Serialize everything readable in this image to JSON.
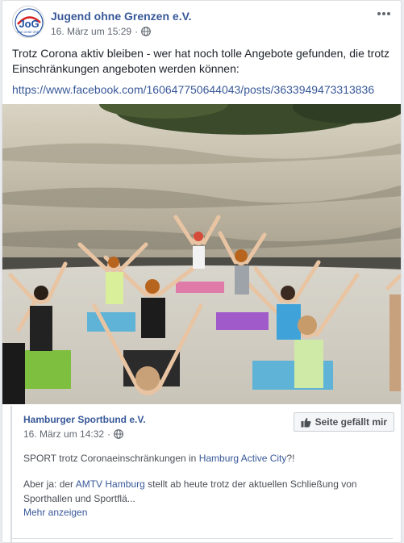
{
  "post": {
    "author": "Jugend ohne Grenzen e.V.",
    "avatar_text": "JoG",
    "date": "16. März um 15:29",
    "separator": "·",
    "audience_icon": "globe-icon",
    "menu_icon": "more-horizontal-icon",
    "text": "Trotz Corona aktiv bleiben - wer hat noch tolle Angebote gefunden, die trotz Einschränkungen angeboten werden können:",
    "link": "https://www.facebook.com/160647750644043/posts/3633949473313836",
    "photo_description_icon": "outdoor-yoga-photo"
  },
  "shared": {
    "author": "Hamburger Sportbund e.V.",
    "date": "16. März um 14:32",
    "separator": "·",
    "like_button": "Seite gefällt mir",
    "line1_before": "SPORT trotz Coronaeinschränkungen in ",
    "line1_link": "Hamburg Active City",
    "line1_after": "?!",
    "line2_before": "Aber ja: der ",
    "line2_link": "AMTV Hamburg",
    "line2_after": " stellt ab heute trotz der aktuellen Schließung von Sporthallen und Sportflä...",
    "more": "Mehr anzeigen"
  },
  "colors": {
    "link": "#385898",
    "text": "#1d2129",
    "meta": "#616770",
    "background": "#e9ebee"
  }
}
